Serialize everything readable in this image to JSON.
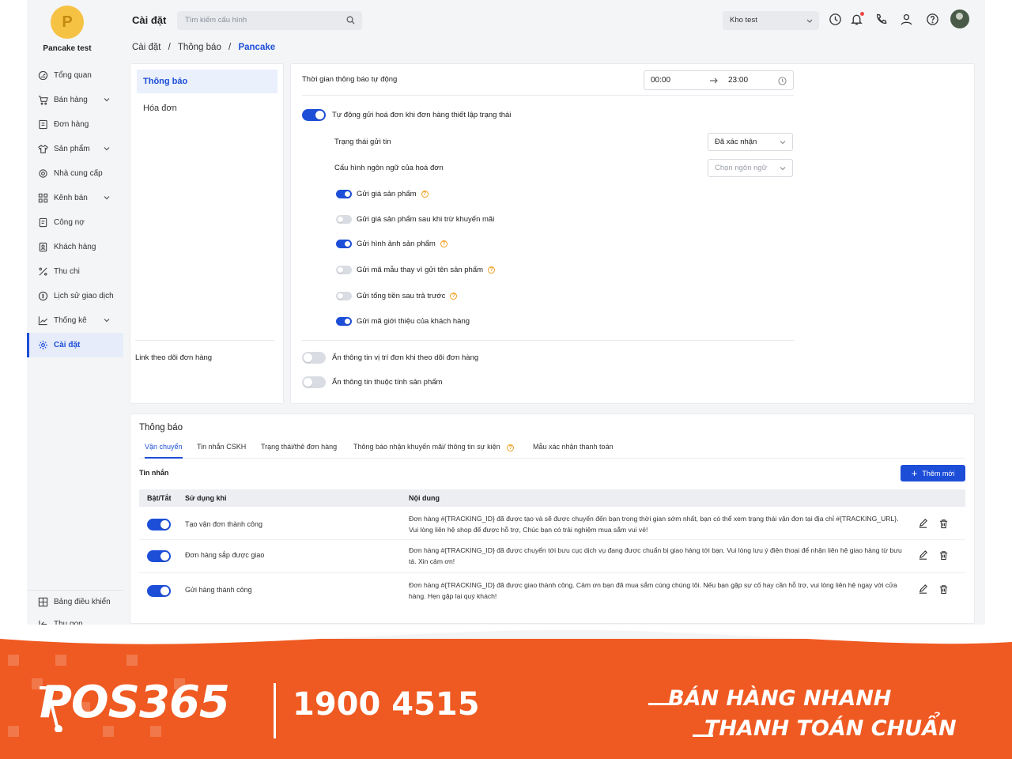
{
  "brand": {
    "initial": "P",
    "name": "Pancake test"
  },
  "header": {
    "title": "Cài đặt",
    "search_placeholder": "Tìm kiếm cấu hình",
    "store": "Kho test"
  },
  "breadcrumb": {
    "items": [
      "Cài đặt",
      "Thông báo"
    ],
    "current": "Pancake",
    "sep": "/"
  },
  "sidebar": {
    "items": [
      {
        "label": "Tổng quan",
        "icon": "dashboard-icon",
        "chevron": false
      },
      {
        "label": "Bán hàng",
        "icon": "cart-icon",
        "chevron": true
      },
      {
        "label": "Đơn hàng",
        "icon": "receipt-icon",
        "chevron": false
      },
      {
        "label": "Sản phẩm",
        "icon": "shirt-icon",
        "chevron": true
      },
      {
        "label": "Nhà cung cấp",
        "icon": "supplier-icon",
        "chevron": false
      },
      {
        "label": "Kênh bán",
        "icon": "channel-icon",
        "chevron": true
      },
      {
        "label": "Công nợ",
        "icon": "debt-icon",
        "chevron": false
      },
      {
        "label": "Khách hàng",
        "icon": "customer-icon",
        "chevron": false
      },
      {
        "label": "Thu chi",
        "icon": "percent-icon",
        "chevron": false
      },
      {
        "label": "Lịch sử giao dịch",
        "icon": "history-icon",
        "chevron": false
      },
      {
        "label": "Thống kê",
        "icon": "chart-icon",
        "chevron": true
      },
      {
        "label": "Cài đặt",
        "icon": "gear-icon",
        "chevron": false,
        "active": true
      }
    ],
    "bottom": [
      {
        "label": "Bảng điều khiển",
        "icon": "panel-icon"
      },
      {
        "label": "Thu gọn",
        "icon": "collapse-icon"
      }
    ]
  },
  "subnav": {
    "items": [
      "Thông báo",
      "Hóa đơn"
    ],
    "link": "Link theo dõi đơn hàng"
  },
  "settings": {
    "auto_time_label": "Thời gian thông báo tự động",
    "time_from": "00:00",
    "time_to": "23:00",
    "auto_send_label": "Tự động gửi hoá đơn khi đơn hàng thiết lập trạng thái",
    "auto_send_on": true,
    "status_label": "Trạng thái gửi tin",
    "status_value": "Đã xác nhận",
    "lang_label": "Cấu hình ngôn ngữ của hoá đơn",
    "lang_placeholder": "Chọn ngôn ngữ",
    "options": [
      {
        "label": "Gửi giá sản phẩm",
        "on": true,
        "help": true
      },
      {
        "label": "Gửi giá sản phẩm sau khi trừ khuyến mãi",
        "on": false,
        "help": false
      },
      {
        "label": "Gửi hình ảnh sản phẩm",
        "on": true,
        "help": true
      },
      {
        "label": "Gửi mã mẫu thay vì gửi tên sản phẩm",
        "on": false,
        "help": true
      },
      {
        "label": "Gửi tổng tiền sau trả trước",
        "on": false,
        "help": true
      },
      {
        "label": "Gửi mã giới thiệu của khách hàng",
        "on": true,
        "help": false
      }
    ],
    "link_options": [
      {
        "label": "Ẩn thông tin vị trí đơn khi theo dõi đơn hàng",
        "on": false
      },
      {
        "label": "Ẩn thông tin thuộc tính sản phẩm",
        "on": false
      }
    ]
  },
  "notifications": {
    "title": "Thông báo",
    "tabs": [
      "Vận chuyển",
      "Tin nhắn CSKH",
      "Trạng thái/thẻ đơn hàng",
      "Thông báo nhận khuyến mãi/ thông tin sự kiện",
      "Mẫu xác nhận thanh toán"
    ],
    "messages_label": "Tin nhắn",
    "add_label": "Thêm mới",
    "columns": [
      "Bật/Tắt",
      "Sử dụng khi",
      "Nội dung"
    ],
    "rows": [
      {
        "on": true,
        "use": "Tạo vận đơn thành công",
        "content": "Đơn hàng #{TRACKING_ID} đã được tạo và sẽ được chuyển đến bạn trong thời gian sớm nhất, bạn có thể xem trạng thái vận đơn tại địa chỉ #{TRACKING_URL}. Vui lòng liên hệ shop để được hỗ trợ, Chúc bạn có trải nghiệm mua sắm vui vẻ!"
      },
      {
        "on": true,
        "use": "Đơn hàng sắp được giao",
        "content": "Đơn hàng #{TRACKING_ID} đã được chuyển tới bưu cục dịch vụ đang được chuẩn bị giao hàng tới bạn. Vui lòng lưu ý điện thoại để nhận liên hệ giao hàng từ bưu tá. Xin cảm ơn!"
      },
      {
        "on": true,
        "use": "Gửi hàng thành công",
        "content": "Đơn hàng #{TRACKING_ID} đã được giao thành công. Cảm ơn bạn đã mua sắm cùng chúng tôi. Nếu bạn gặp sự cố hay cần hỗ trợ, vui lòng liên hệ ngay với cửa hàng. Hẹn gặp lại quý khách!"
      }
    ]
  },
  "banner": {
    "logo": "POS365",
    "phone": "1900 4515",
    "slogan_1": "BÁN HÀNG NHANH",
    "slogan_2": "THANH TOÁN CHUẨN",
    "color": "#ef5a22"
  },
  "colors": {
    "accent": "#1d4ed8",
    "brand_avatar": "#f6c244",
    "help": "#f0a020"
  }
}
